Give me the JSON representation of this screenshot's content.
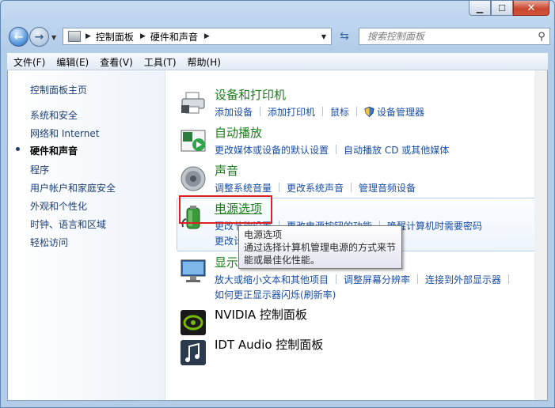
{
  "window": {
    "caption": {
      "minimize": "▁",
      "maximize": "☐",
      "close": "✕"
    }
  },
  "address": {
    "crumbs": [
      "控制面板",
      "硬件和声音"
    ]
  },
  "search": {
    "placeholder": "搜索控制面板"
  },
  "menu": [
    "文件(F)",
    "编辑(E)",
    "查看(V)",
    "工具(T)",
    "帮助(H)"
  ],
  "sidebar": {
    "items": [
      {
        "label": "控制面板主页",
        "active": false
      },
      {
        "label": "系统和安全",
        "active": false
      },
      {
        "label": "网络和 Internet",
        "active": false
      },
      {
        "label": "硬件和声音",
        "active": true
      },
      {
        "label": "程序",
        "active": false
      },
      {
        "label": "用户帐户和家庭安全",
        "active": false
      },
      {
        "label": "外观和个性化",
        "active": false
      },
      {
        "label": "时钟、语言和区域",
        "active": false
      },
      {
        "label": "轻松访问",
        "active": false
      }
    ]
  },
  "categories": [
    {
      "title": "设备和打印机",
      "icon": "printer-icon",
      "links": [
        "添加设备",
        "添加打印机",
        "鼠标",
        "设备管理器"
      ]
    },
    {
      "title": "自动播放",
      "icon": "autoplay-icon",
      "links": [
        "更改媒体或设备的默认设置",
        "自动播放 CD 或其他媒体"
      ]
    },
    {
      "title": "声音",
      "icon": "speaker-icon",
      "links": [
        "调整系统音量",
        "更改系统声音",
        "管理音频设备"
      ]
    },
    {
      "title": "电源选项",
      "icon": "power-battery-icon",
      "links": [
        "更改节能设置",
        "更改电源按钮的功能",
        "唤醒计算机时需要密码"
      ],
      "links2": [
        "更改计算机睡眠时间"
      ]
    },
    {
      "title": "显示",
      "icon": "display-icon",
      "links": [
        "放大或缩小文本和其他项目",
        "调整屏幕分辨率",
        "连接到外部显示器"
      ],
      "links2": [
        "如何更正显示器闪烁(刷新率)"
      ]
    },
    {
      "title": "NVIDIA 控制面板",
      "icon": "nvidia-icon",
      "links": []
    },
    {
      "title": "IDT Audio 控制面板",
      "icon": "idt-audio-icon",
      "links": []
    }
  ],
  "tooltip": {
    "title": "电源选项",
    "text": "通过选择计算机管理电源的方式来节能或最佳化性能。"
  },
  "colors": {
    "category_title": "#1c7d1c",
    "link": "#1a4ea3",
    "highlight": "#e02020"
  }
}
